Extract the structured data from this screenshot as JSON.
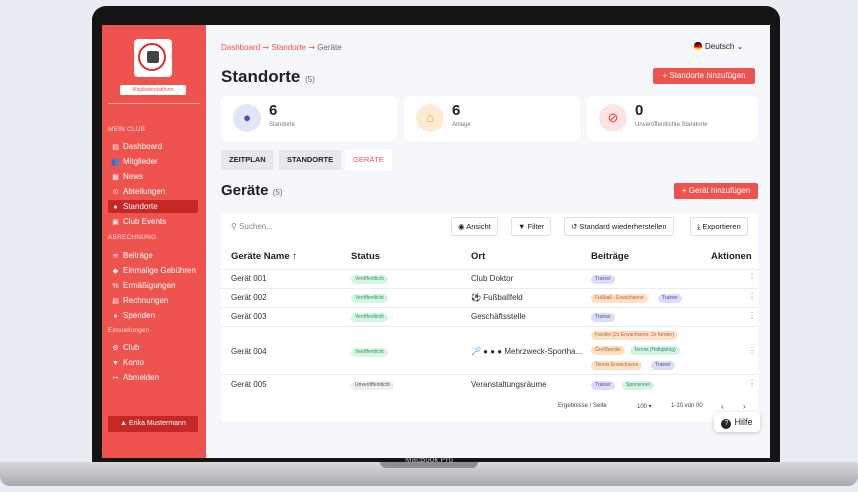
{
  "device_label": "MacBook Pro",
  "sidebar": {
    "platform_badge": "Mitgliederplattform",
    "section_club": "MEIN CLUB",
    "club_items": [
      {
        "icon": "dashboard-icon",
        "glyph": "▤",
        "label": "Dashboard"
      },
      {
        "icon": "members-icon",
        "glyph": "👥",
        "label": "Mitglieder"
      },
      {
        "icon": "news-icon",
        "glyph": "▦",
        "label": "News"
      },
      {
        "icon": "departments-icon",
        "glyph": "⊙",
        "label": "Abteilungen"
      },
      {
        "icon": "location-icon",
        "glyph": "●",
        "label": "Standorte"
      },
      {
        "icon": "calendar-icon",
        "glyph": "▣",
        "label": "Club Events"
      }
    ],
    "section_billing": "ABRECHNUNG",
    "billing_items": [
      {
        "icon": "coins-icon",
        "glyph": "≋",
        "label": "Beiträge"
      },
      {
        "icon": "tag-icon",
        "glyph": "◆",
        "label": "Einmalige Gebühren"
      },
      {
        "icon": "percent-icon",
        "glyph": "%",
        "label": "Ermäßigungen"
      },
      {
        "icon": "invoice-icon",
        "glyph": "▤",
        "label": "Rechnungen"
      },
      {
        "icon": "donation-icon",
        "glyph": "♦",
        "label": "Spenden"
      }
    ],
    "section_settings": "Einstellungen",
    "settings_items": [
      {
        "icon": "gear-icon",
        "glyph": "⚙",
        "label": "Club"
      },
      {
        "icon": "cart-icon",
        "glyph": "▼",
        "label": "Konto"
      },
      {
        "icon": "logout-icon",
        "glyph": "↦",
        "label": "Abmelden"
      }
    ],
    "user_name": "Erika Mustermann"
  },
  "header": {
    "breadcrumb": [
      "Dashboard",
      "Standorte",
      "Geräte"
    ],
    "language": "Deutsch"
  },
  "page": {
    "title": "Standorte",
    "title_count": "(5)",
    "add_button": "+ Standorte hinzufügen"
  },
  "stats": [
    {
      "icon": "location-pin-icon",
      "value": "6",
      "label": "Standorte"
    },
    {
      "icon": "building-icon",
      "value": "6",
      "label": "Anlage"
    },
    {
      "icon": "hidden-eye-icon",
      "value": "0",
      "label": "Unveröffentlichte Standorte"
    }
  ],
  "tabs": [
    "ZEITPLAN",
    "STANDORTE",
    "GERÄTE"
  ],
  "section": {
    "title": "Geräte",
    "count": "(5)",
    "add_button": "+ Gerät hinzufügen"
  },
  "toolbar": {
    "search_placeholder": "Suchen...",
    "view": "Ansicht",
    "filter": "Filter",
    "reset": "Standard wiederherstellen",
    "export": "Exportieren"
  },
  "table": {
    "columns": [
      "Geräte Name ↑",
      "Status",
      "Ort",
      "Beiträge",
      "Aktionen"
    ],
    "rows": [
      {
        "name": "Gerät 001",
        "status": "Veröffentlicht",
        "location": "Club Doktor",
        "fees": [
          "Trainer"
        ]
      },
      {
        "name": "Gerät 002",
        "status": "Veröffentlicht",
        "location": "⚽ Fußballfeld",
        "fees": [
          "Fußball - Erwachsene",
          "Trainer"
        ]
      },
      {
        "name": "Gerät 003",
        "status": "Veröffentlicht",
        "location": "Geschäftsstelle",
        "fees": [
          "Trainer"
        ]
      },
      {
        "name": "Gerät 004",
        "status": "Veröffentlicht",
        "location": "🏸 ● ● ● Mehrzweck-Sportha...",
        "fees": [
          "Familie (2x Erwachsene, 2x Kinder)",
          "Großfamilie",
          "Tennis (Halbjährig)",
          "Tennis Erwachsene",
          "Trainer"
        ]
      },
      {
        "name": "Gerät 005",
        "status": "Unveröffentlicht",
        "location": "Veranstaltungsräume",
        "fees": [
          "Trainer",
          "Sponsoren"
        ]
      }
    ]
  },
  "pagination": {
    "label": "Ergebnisse / Seite",
    "per_page": "100",
    "range": "1-10 von 00"
  },
  "help_label": "Hilfe",
  "colors": {
    "accent": "#ef5350",
    "accent_dark": "#c62828"
  }
}
